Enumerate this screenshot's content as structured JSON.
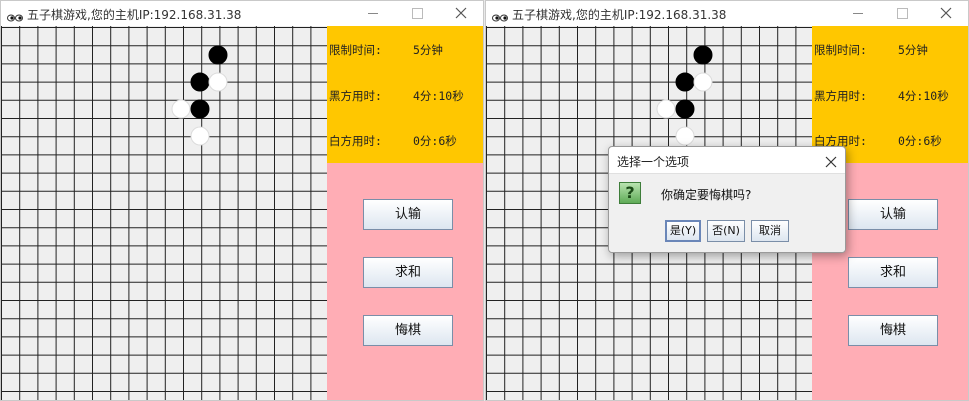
{
  "windows": [
    {
      "title": "五子棋游戏,您的主机IP:192.168.31.38",
      "info": {
        "time_limit_label": "限制时间:",
        "time_limit_value": "5分钟",
        "black_time_label": "黑方用时:",
        "black_time_value": "4分:10秒",
        "white_time_label": "白方用时:",
        "white_time_value": "0分:6秒"
      },
      "buttons": {
        "resign": "认输",
        "draw": "求和",
        "undo": "悔棋"
      }
    },
    {
      "title": "五子棋游戏,您的主机IP:192.168.31.38",
      "info": {
        "time_limit_label": "限制时间:",
        "time_limit_value": "5分钟",
        "black_time_label": "黑方用时:",
        "black_time_value": "4分:10秒",
        "white_time_label": "白方用时:",
        "white_time_value": "0分:6秒"
      },
      "buttons": {
        "resign": "认输",
        "draw": "求和",
        "undo": "悔棋"
      }
    }
  ],
  "board": {
    "stones": [
      {
        "color": "black",
        "col": 7,
        "row": 1
      },
      {
        "color": "black",
        "col": 6,
        "row": 2
      },
      {
        "color": "black",
        "col": 6,
        "row": 3
      },
      {
        "color": "white",
        "col": 7,
        "row": 2
      },
      {
        "color": "white",
        "col": 5,
        "row": 3
      },
      {
        "color": "white",
        "col": 6,
        "row": 4
      }
    ]
  },
  "dialog": {
    "title": "选择一个选项",
    "icon": "question-icon",
    "message": "你确定要悔棋吗?",
    "yes_label": "是(Y)",
    "no_label": "否(N)",
    "cancel_label": "取消"
  },
  "colors": {
    "info_bg": "#ffc700",
    "controls_bg": "#ffadb5",
    "board_bg": "#efefef"
  }
}
